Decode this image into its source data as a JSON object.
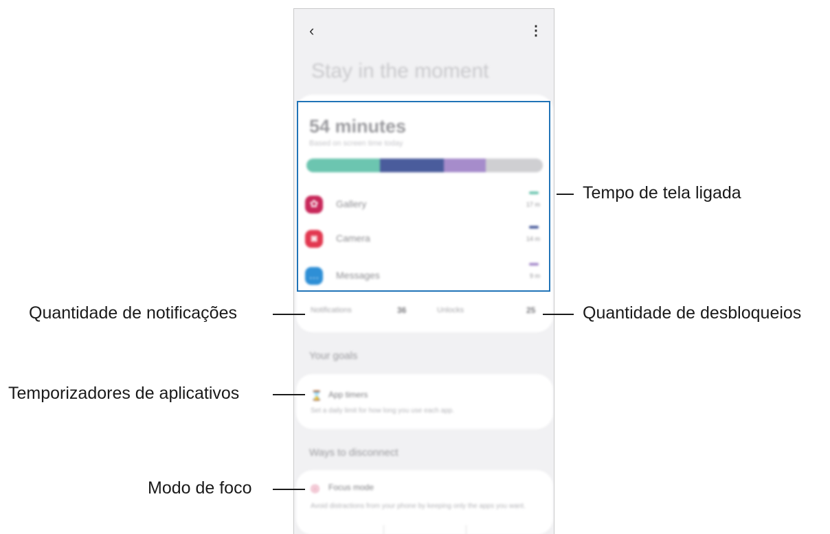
{
  "screen": {
    "title": "Stay in the moment",
    "total_time": "54 minutes",
    "total_sub": "Based on screen time today",
    "usage_segments": [
      {
        "fraction": 0.31,
        "color": "#6cc5b0"
      },
      {
        "fraction": 0.27,
        "color": "#4a5c9c"
      },
      {
        "fraction": 0.18,
        "color": "#a68ccb"
      },
      {
        "fraction": 0.24,
        "color": "#cfcfd2"
      }
    ],
    "apps": [
      {
        "name": "Gallery",
        "time": "17 m",
        "icon": "gallery-icon",
        "glyph": "✿",
        "icon_color": "#c8285a",
        "dash_color": "#6cc5b0"
      },
      {
        "name": "Camera",
        "time": "14 m",
        "icon": "camera-icon",
        "glyph": "◙",
        "icon_color": "#e23850",
        "dash_color": "#4a5c9c"
      },
      {
        "name": "Messages",
        "time": "9 m",
        "icon": "messages-icon",
        "glyph": "…",
        "icon_color": "#2e8fd6",
        "dash_color": "#a68ccb"
      }
    ],
    "stats": {
      "notifications_label": "Notifications",
      "notifications_value": "36",
      "unlocks_label": "Unlocks",
      "unlocks_value": "25"
    },
    "goals_title": "Your goals",
    "app_timers": {
      "name": "App timers",
      "description": "Set a daily limit for how long you use each app.",
      "icon": "hourglass-icon",
      "glyph": "⌛"
    },
    "disconnect_title": "Ways to disconnect",
    "focus_mode": {
      "name": "Focus mode",
      "description": "Avoid distractions from your phone by keeping only the apps you want.",
      "icon": "focus-icon",
      "glyph": "◎"
    },
    "back_glyph": "‹",
    "more_glyph": "⋮"
  },
  "callouts": {
    "screen_time": "Tempo de tela ligada",
    "notifications": "Quantidade de notificações",
    "unlocks": "Quantidade de desbloqueios",
    "app_timers": "Temporizadores de aplicativos",
    "focus_mode": "Modo de foco"
  },
  "highlight_color": "#1f73b7"
}
